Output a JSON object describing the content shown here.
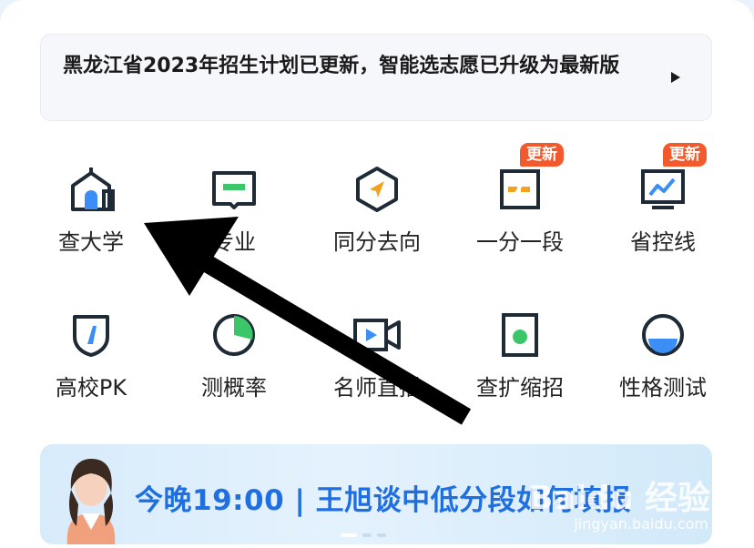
{
  "notice": {
    "text": "黑龙江省2023年招生计划已更新，智能选志愿已升级为最新版"
  },
  "tools": [
    {
      "label": "查大学",
      "icon": "university-icon",
      "badge": ""
    },
    {
      "label": "专业",
      "icon": "book-icon",
      "badge": ""
    },
    {
      "label": "同分去向",
      "icon": "compass-hex-icon",
      "badge": ""
    },
    {
      "label": "一分一段",
      "icon": "score-table-icon",
      "badge": "更新"
    },
    {
      "label": "省控线",
      "icon": "line-chart-icon",
      "badge": "更新"
    },
    {
      "label": "高校PK",
      "icon": "shield-icon",
      "badge": ""
    },
    {
      "label": "测概率",
      "icon": "pie-chart-icon",
      "badge": ""
    },
    {
      "label": "名师直播",
      "icon": "video-camera-icon",
      "badge": ""
    },
    {
      "label": "查扩缩招",
      "icon": "document-icon",
      "badge": ""
    },
    {
      "label": "性格测试",
      "icon": "circle-gauge-icon",
      "badge": ""
    }
  ],
  "banner": {
    "text": "今晚19:00 | 王旭谈中低分段如何填报"
  },
  "watermark": {
    "brand": "Baidu 经验",
    "url": "jingyan.baidu.com"
  },
  "colors": {
    "accent_blue": "#3a8ef5",
    "accent_green": "#3cc66a",
    "accent_orange": "#f2a31d",
    "badge_red": "#f25a2d",
    "icon_dark": "#1e2a35"
  }
}
